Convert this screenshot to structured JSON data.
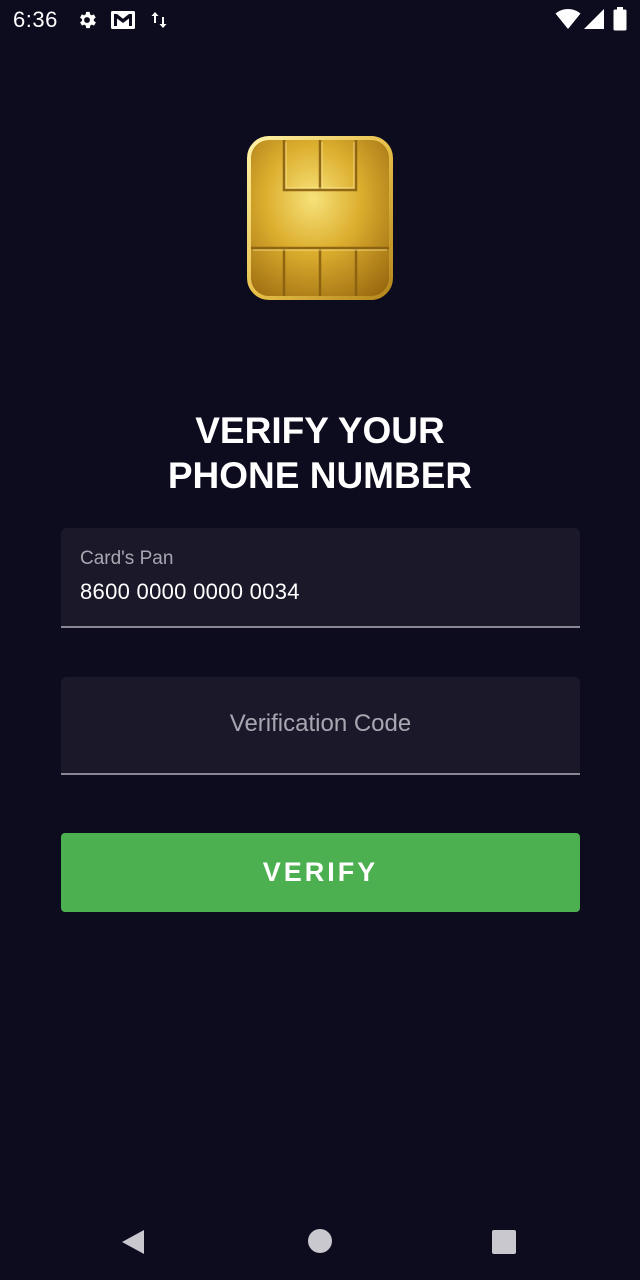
{
  "status_bar": {
    "time": "6:36",
    "icons": [
      "gear-icon",
      "gmail-icon",
      "data-transfer-icon",
      "wifi-icon",
      "signal-icon",
      "battery-icon"
    ]
  },
  "chip": {
    "icon": "sim-chip-icon",
    "color": "#d9a92a"
  },
  "title": {
    "line1": "VERIFY YOUR",
    "line2": "PHONE NUMBER"
  },
  "card_pan_field": {
    "label": "Card's Pan",
    "value": "8600 0000 0000 0034"
  },
  "verification_code_field": {
    "placeholder": "Verification Code",
    "value": ""
  },
  "verify_button": {
    "label": "VERIFY",
    "color": "#4caf50"
  },
  "nav_bar": {
    "icons": [
      "back-icon",
      "home-icon",
      "recents-icon"
    ]
  },
  "colors": {
    "background": "#0d0b1e",
    "field_background": "#1b1829"
  }
}
